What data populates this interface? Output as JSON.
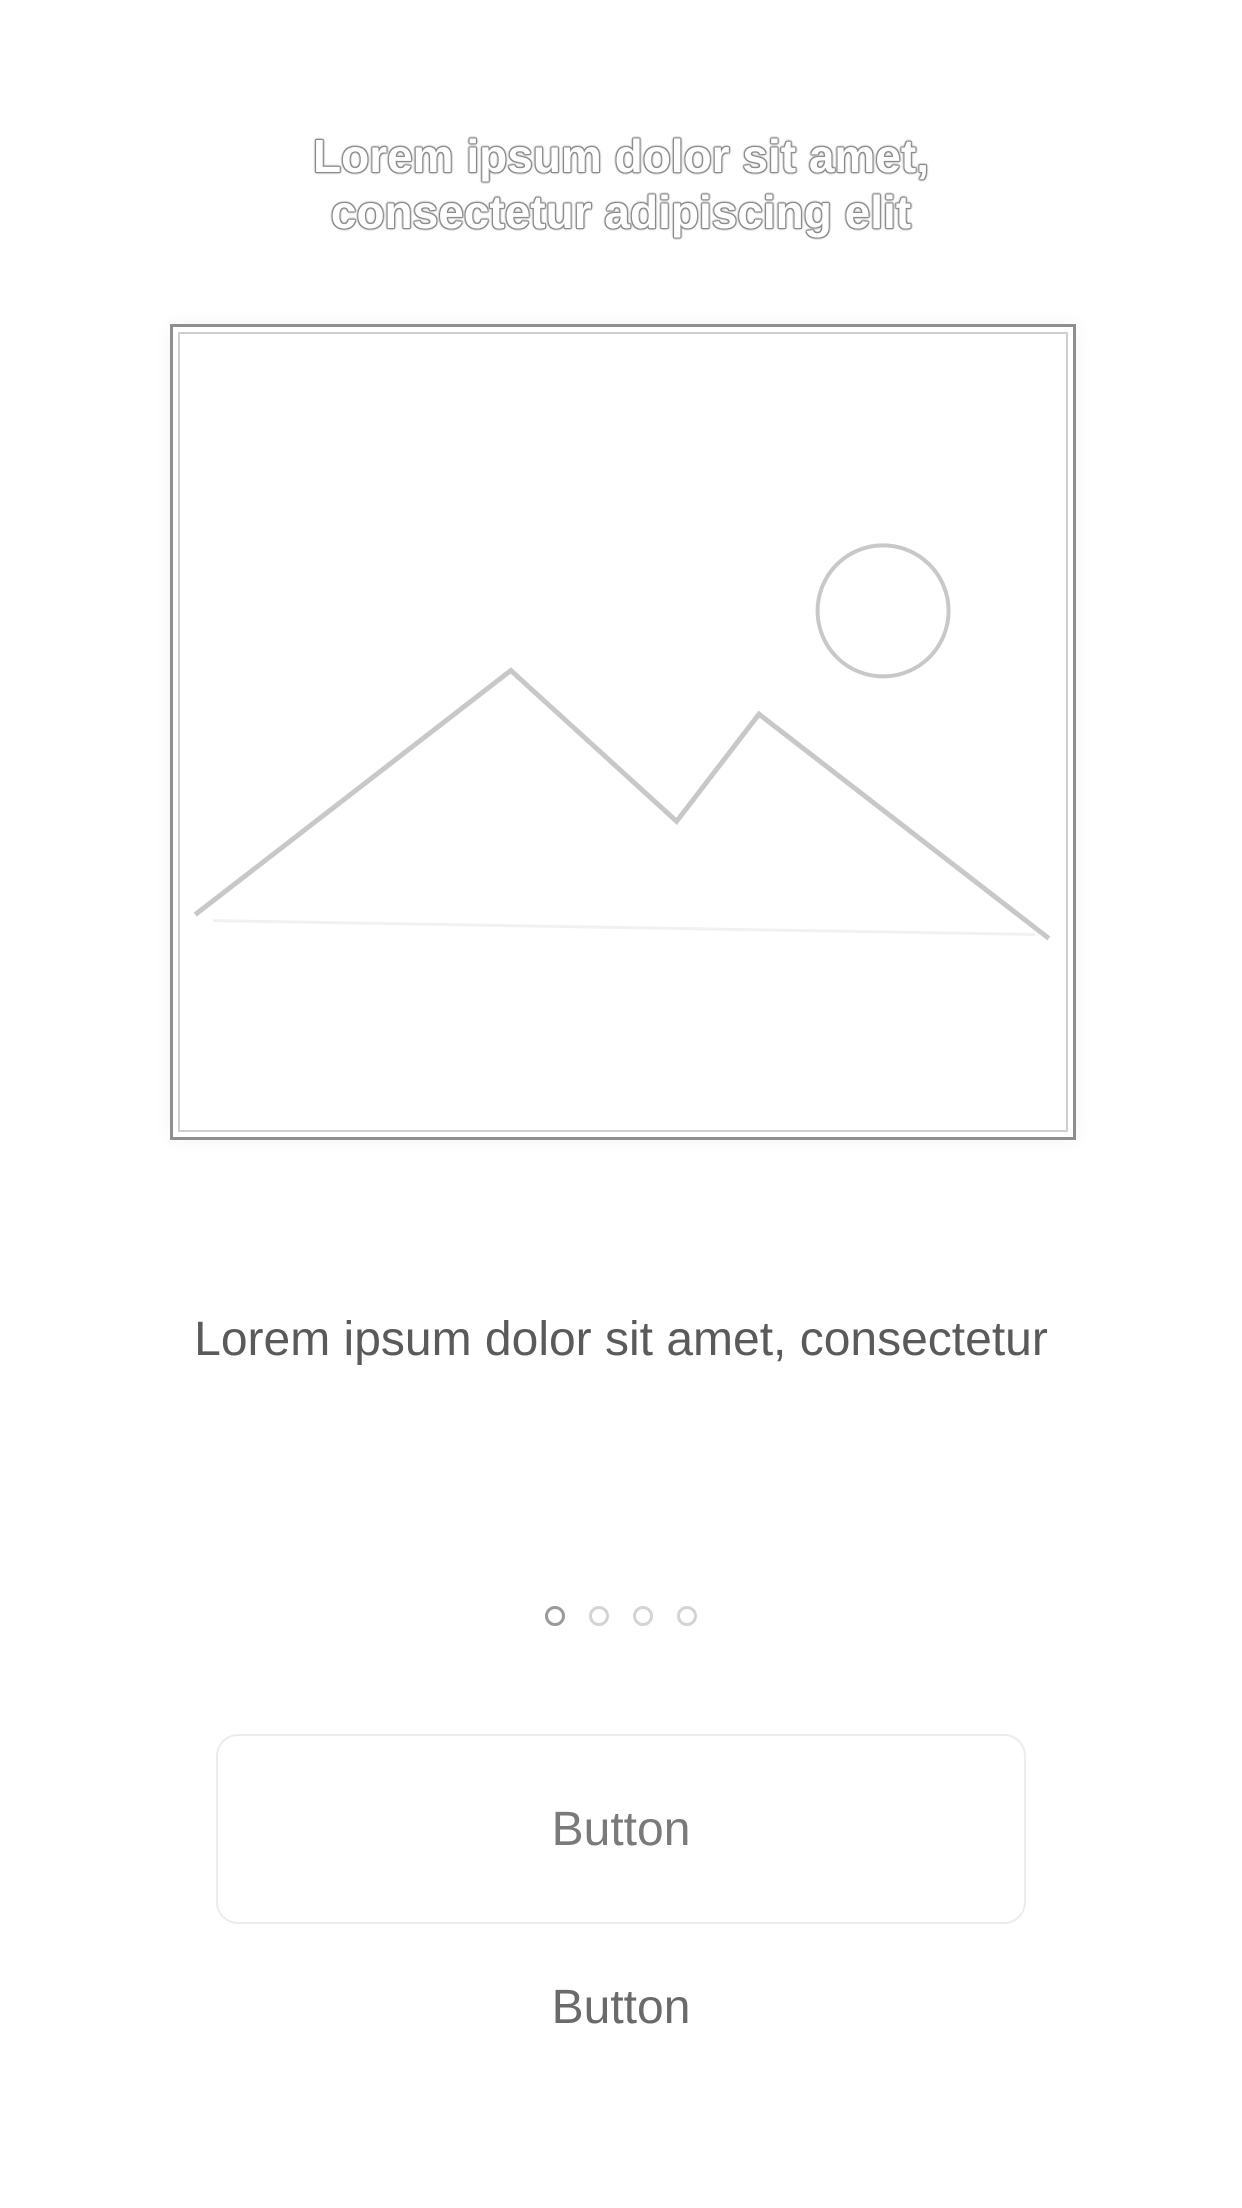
{
  "header": {
    "title_line1": "Lorem ipsum dolor sit amet,",
    "title_line2": "consectetur adipiscing elit"
  },
  "hero": {
    "image_icon": "image-placeholder-icon"
  },
  "content": {
    "body_text": "Lorem ipsum dolor sit amet, consectetur"
  },
  "pagination": {
    "count": 4,
    "active_index": 0
  },
  "actions": {
    "primary_label": "Button",
    "secondary_label": "Button"
  },
  "colors": {
    "background": "#ffffff",
    "text": "#5a5a5a",
    "border": "#ececec"
  }
}
